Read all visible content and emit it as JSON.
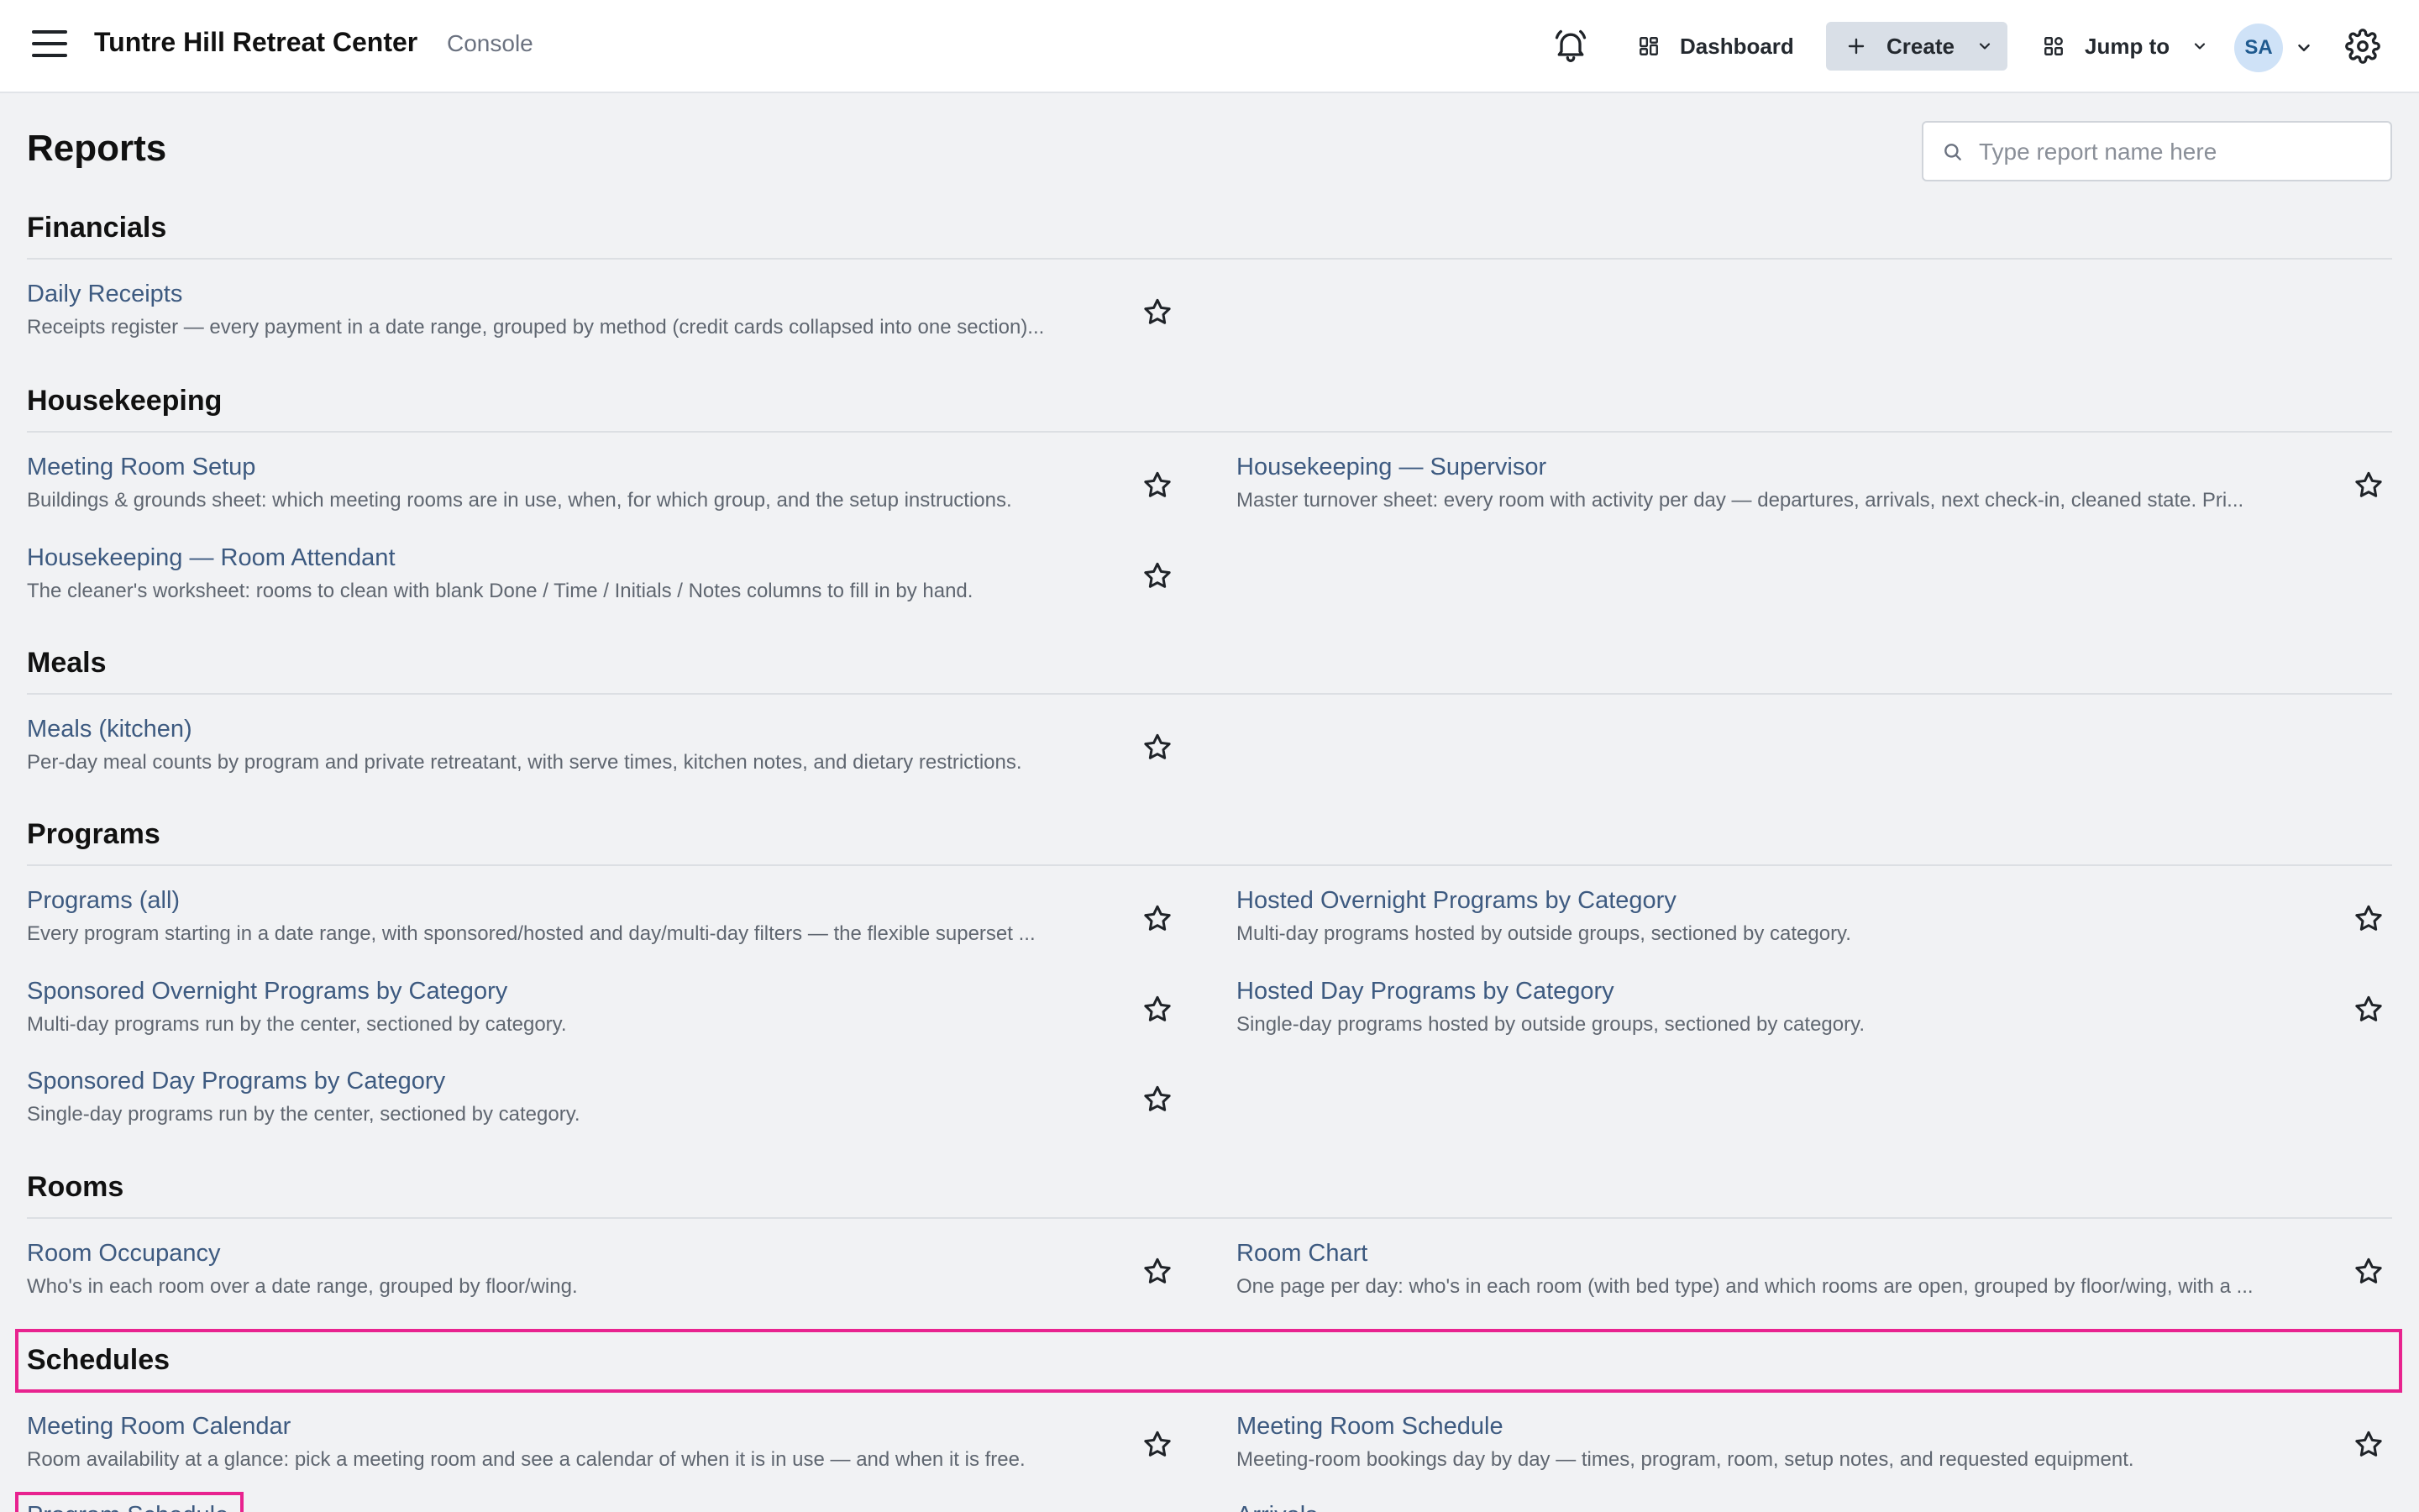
{
  "header": {
    "app_title": "Tuntre Hill Retreat Center",
    "app_subtitle": "Console",
    "nav": {
      "dashboard": "Dashboard",
      "create": "Create",
      "jump_to": "Jump to"
    },
    "avatar_initials": "SA"
  },
  "page": {
    "title": "Reports",
    "search_placeholder": "Type report name here"
  },
  "sections": {
    "financials": {
      "title": "Financials",
      "reports": [
        {
          "name": "Daily Receipts",
          "desc": "Receipts register — every payment in a date range, grouped by method (credit cards collapsed into one section)..."
        }
      ]
    },
    "housekeeping": {
      "title": "Housekeeping",
      "reports": [
        {
          "name": "Meeting Room Setup",
          "desc": "Buildings & grounds sheet: which meeting rooms are in use, when, for which group, and the setup instructions."
        },
        {
          "name": "Housekeeping — Supervisor",
          "desc": "Master turnover sheet: every room with activity per day — departures, arrivals, next check-in, cleaned state. Pri..."
        },
        {
          "name": "Housekeeping — Room Attendant",
          "desc": "The cleaner's worksheet: rooms to clean with blank Done / Time / Initials / Notes columns to fill in by hand."
        }
      ]
    },
    "meals": {
      "title": "Meals",
      "reports": [
        {
          "name": "Meals (kitchen)",
          "desc": "Per-day meal counts by program and private retreatant, with serve times, kitchen notes, and dietary restrictions."
        }
      ]
    },
    "programs": {
      "title": "Programs",
      "reports": [
        {
          "name": "Programs (all)",
          "desc": "Every program starting in a date range, with sponsored/hosted and day/multi-day filters — the flexible superset ..."
        },
        {
          "name": "Hosted Overnight Programs by Category",
          "desc": "Multi-day programs hosted by outside groups, sectioned by category."
        },
        {
          "name": "Sponsored Overnight Programs by Category",
          "desc": "Multi-day programs run by the center, sectioned by category."
        },
        {
          "name": "Hosted Day Programs by Category",
          "desc": "Single-day programs hosted by outside groups, sectioned by category."
        },
        {
          "name": "Sponsored Day Programs by Category",
          "desc": "Single-day programs run by the center, sectioned by category."
        }
      ]
    },
    "rooms": {
      "title": "Rooms",
      "reports": [
        {
          "name": "Room Occupancy",
          "desc": "Who's in each room over a date range, grouped by floor/wing."
        },
        {
          "name": "Room Chart",
          "desc": "One page per day: who's in each room (with bed type) and which rooms are open, grouped by floor/wing, with a ..."
        }
      ]
    },
    "schedules": {
      "title": "Schedules",
      "reports": [
        {
          "name": "Meeting Room Calendar",
          "desc": "Room availability at a glance: pick a meeting room and see a calendar of when it is in use — and when it is free."
        },
        {
          "name": "Meeting Room Schedule",
          "desc": "Meeting-room bookings day by day — times, program, room, setup notes, and requested equipment."
        },
        {
          "name": "Program Schedule",
          "desc": ""
        },
        {
          "name": "Arrivals",
          "desc": ""
        }
      ]
    }
  },
  "colors": {
    "highlight": "#e8238f",
    "link": "#3d5a80",
    "background": "#f1f2f4"
  }
}
